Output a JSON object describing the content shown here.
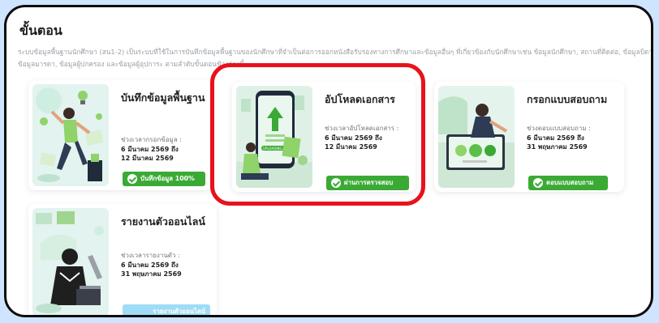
{
  "section": {
    "title": "ขั้นตอน",
    "description": "ระบบข้อมูลพื้นฐานนักศึกษา (สน1-2) เป็นระบบที่ใช้ในการบันทึกข้อมูลพื้นฐานของนักศึกษาที่จำเป็นต่อการออกหนังสือรับรองทางการศึกษาและข้อมูลอื่นๆ ที่เกี่ยวข้องกับนักศึกษาเช่น ข้อมูลนักศึกษา, สถานที่ติดต่อ, ข้อมูลบิดา, ข้อมูลมารดา, ข้อมูลผู้ปกครอง และข้อมูลผู้อุปการะ ตามลำดับขั้นตอนข้างล่างนี้"
  },
  "steps": [
    {
      "title": "บันทึกข้อมูลพื้นฐาน",
      "period_label": "ช่วงเวลากรอกข้อมูล :",
      "start": "6 มีนาคม 2569 ถึง",
      "end": "12 มีนาคม 2569",
      "button": "บันทึกข้อมูล 100%",
      "illustration": "person-with-lightbulbs-illustration"
    },
    {
      "title": "อัปโหลดเอกสาร",
      "period_label": "ช่วงเวลาอัปโหลดเอกสาร :",
      "start": "6 มีนาคม 2569 ถึง",
      "end": "12 มีนาคม 2569",
      "button": "ผ่านการตรวจสอบ",
      "illustration_text": "UPLOADING...",
      "illustration": "phone-upload-illustration"
    },
    {
      "title": "กรอกแบบสอบถาม",
      "period_label": "ช่วงตอบแบบสอบถาม :",
      "start": "6 มีนาคม 2569 ถึง",
      "end": "31 พฤษภาคม 2569",
      "button": "ตอบแบบสอบถาม",
      "illustration": "survey-rating-illustration"
    },
    {
      "title": "รายงานตัวออนไลน์",
      "period_label": "ช่วงเวลารายงานตัว :",
      "start": "6 มีนาคม 2569 ถึง",
      "end": "31 พฤษภาคม 2569",
      "button": "รายงานตัวออนไลน์",
      "illustration": "person-with-laptop-illustration"
    }
  ],
  "colors": {
    "button_green": "#3aaa35",
    "button_disabled": "#9fdcf5",
    "highlight": "#e8121b"
  }
}
